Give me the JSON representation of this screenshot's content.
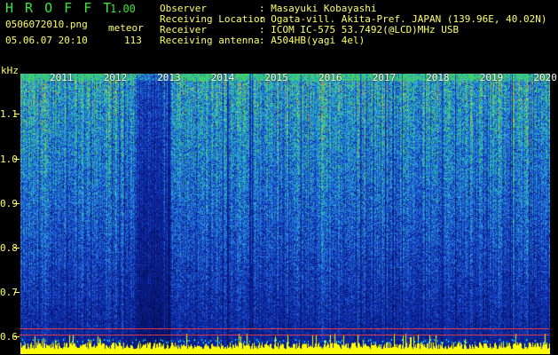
{
  "header": {
    "brand": "H R O F F T",
    "version": "1.00",
    "filename": "0506072010.png",
    "datetime": "05.06.07 20:10",
    "mode_label": "meteor",
    "count": "113"
  },
  "info": {
    "observer_label": "Observer",
    "observer_value": ": Masayuki Kobayashi",
    "location_label": "Receiving Location",
    "location_value": ": Ogata-vill. Akita-Pref. JAPAN (139.96E, 40.02N)",
    "receiver_label": "Receiver",
    "receiver_value": ": ICOM IC-575 53.7492(@LCD)MHz USB",
    "antenna_label": "Receiving antenna",
    "antenna_value": ": A504HB(yagi 4el)"
  },
  "axis": {
    "unit": "kHz",
    "y_ticks": [
      "1.1",
      "1.0",
      "0.9",
      "0.8",
      "0.7",
      "0.6"
    ],
    "years": [
      "2011",
      "2012",
      "2013",
      "2014",
      "2015",
      "2016",
      "2017",
      "2018",
      "2019",
      "2020"
    ]
  },
  "colors": {
    "background": "#000000",
    "header_green": "#39e639",
    "header_yellow": "#ffff66",
    "spectrogram_low": "#0a1a8c",
    "spectrogram_mid": "#2a6fd9",
    "spectrogram_high": "#33cc66",
    "baseline": "#ffff00"
  }
}
